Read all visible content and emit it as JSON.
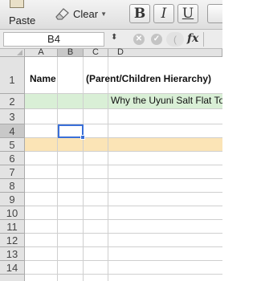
{
  "ribbon": {
    "paste_label": "Paste",
    "clear_label": "Clear",
    "bold_label": "B",
    "italic_label": "I",
    "underline_label": "U"
  },
  "formula_bar": {
    "name_box": "B4",
    "fx_label": "fx"
  },
  "grid": {
    "columns": [
      "A",
      "B",
      "C",
      "D"
    ],
    "selected_column": "B",
    "selected_row": "4",
    "rows": [
      "1",
      "2",
      "3",
      "4",
      "5",
      "6",
      "7",
      "8",
      "9",
      "10",
      "11",
      "12",
      "13",
      "14"
    ],
    "header_row": {
      "name": "Name",
      "hierarchy": "(Parent/Children Hierarchy)"
    },
    "row2_text": "Why the Uyuni Salt Flat To",
    "colors": {
      "green_row": "#d9efd6",
      "orange_row": "#fbe4b6",
      "selection": "#3a6fd8"
    }
  }
}
